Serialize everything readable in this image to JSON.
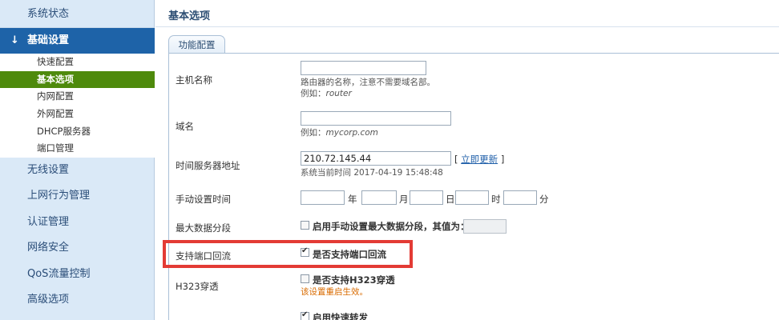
{
  "sidebar": {
    "top_item": "系统状态",
    "active_section": "基础设置",
    "sub_items": [
      "快速配置",
      "基本选项",
      "内网配置",
      "外网配置",
      "DHCP服务器",
      "端口管理"
    ],
    "main_items": [
      "无线设置",
      "上网行为管理",
      "认证管理",
      "网络安全",
      "QoS流量控制",
      "高级选项"
    ]
  },
  "page": {
    "title": "基本选项",
    "tab": "功能配置"
  },
  "form": {
    "hostname": {
      "label": "主机名称",
      "value": "",
      "hint": "路由器的名称，注意不需要域名部。",
      "example_prefix": "例如：",
      "example": "router"
    },
    "domain": {
      "label": "域名",
      "value": "",
      "example_prefix": "例如：",
      "example": "mycorp.com"
    },
    "time_server": {
      "label": "时间服务器地址",
      "value": "210.72.145.44",
      "update_link": "立即更新",
      "bracket_open": "[",
      "bracket_close": "]",
      "current_time": "系统当前时间 2017-04-19 15:48:48"
    },
    "manual_time": {
      "label": "手动设置时间",
      "units": [
        "年",
        "月",
        "日",
        "时",
        "分"
      ]
    },
    "max_segment": {
      "label": "最大数据分段",
      "checkbox_label": "启用手动设置最大数据分段，其值为：",
      "checked": false,
      "value": ""
    },
    "port_loopback": {
      "label": "支持端口回流",
      "checkbox_label": "是否支持端口回流",
      "checked": true
    },
    "h323": {
      "label": "H323穿透",
      "checkbox_label": "是否支持H323穿透",
      "checked": false,
      "warning": "该设置重启生效。"
    },
    "fast_forward": {
      "checkbox_label": "启用快速转发",
      "checked": true
    }
  },
  "colors": {
    "sidebar_bg": "#dae9f7",
    "active_bg": "#1e63a8",
    "selected_sub_bg": "#4e8a0c",
    "highlight_border": "#e33b35",
    "warning_text": "#d96b00"
  }
}
